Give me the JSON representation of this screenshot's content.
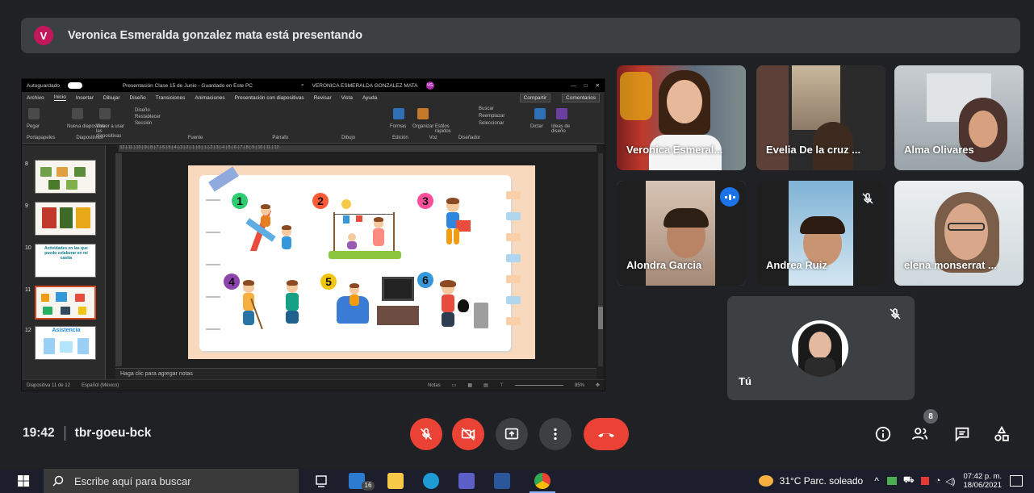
{
  "banner": {
    "avatar_letter": "V",
    "text": "Veronica Esmeralda gonzalez mata está presentando",
    "avatar_color": "#c2185b"
  },
  "ppt": {
    "autosave": "Autoguardado",
    "file_title": "Presentación Clase 15 de Junio - Guardado en Este PC",
    "user": "VERONICA ESMERALDA GONZALEZ MATA",
    "user_initials": "VG",
    "tabs": [
      "Archivo",
      "Inicio",
      "Insertar",
      "Dibujar",
      "Diseño",
      "Transiciones",
      "Animaciones",
      "Presentación con diapositivas",
      "Revisar",
      "Vista",
      "Ayuda"
    ],
    "share_button": "Compartir",
    "comments_button": "Comentarios",
    "ribbon_groups": [
      "Portapapeles",
      "Diapositivas",
      "Fuente",
      "Párrafo",
      "Dibujo",
      "Edición",
      "Voz",
      "Diseñador"
    ],
    "ribbon_labels": [
      "Pegar",
      "Nueva diapositiva",
      "Volver a usar las diapositivas",
      "Diseño",
      "Restablecer",
      "Sección",
      "Formas",
      "Organizar",
      "Estilos rápidos",
      "Buscar",
      "Reemplazar",
      "Seleccionar",
      "Dictar",
      "Ideas de diseño"
    ],
    "ruler": "·12·|·11·|·10·|·9·|·8·|·7·|·6·|·5·|·4·|·3·|·2·|·1·|·0·|·1·|·2·|·3·|·4·|·5·|·6·|·7·|·8·|·9·|·10·|·11·|·12·",
    "thumbnails": [
      {
        "num": "8"
      },
      {
        "num": "9"
      },
      {
        "num": "10",
        "title": "Actividades en las que puedo colaborar en mi casita"
      },
      {
        "num": "11"
      },
      {
        "num": "12",
        "title": "Asistencia"
      }
    ],
    "notes_placeholder": "Haga clic para agregar notas",
    "status": {
      "slide": "Diapositiva 11 de 12",
      "language": "Español (México)",
      "notes": "Notas",
      "zoom": "85%"
    }
  },
  "slide": {
    "numbers": [
      "1",
      "2",
      "3",
      "4",
      "5",
      "6"
    ]
  },
  "participants": [
    {
      "name": "Veronica Esmeral...",
      "state": "normal"
    },
    {
      "name": "Evelia De la cruz ...",
      "state": "normal"
    },
    {
      "name": "Alma Olivares",
      "state": "normal"
    },
    {
      "name": "Alondra Garcia",
      "state": "speaking"
    },
    {
      "name": "Andrea Ruiz",
      "state": "muted"
    },
    {
      "name": "elena monserrat ...",
      "state": "normal"
    }
  ],
  "self": {
    "name": "Tú",
    "muted": true
  },
  "meeting": {
    "time": "19:42",
    "code": "tbr-goeu-bck",
    "participant_count": "8"
  },
  "taskbar": {
    "search_placeholder": "Escribe aquí para buscar",
    "badge": "16",
    "weather": "31°C Parc. soleado",
    "time": "07:42 p. m.",
    "date": "18/06/2021"
  }
}
